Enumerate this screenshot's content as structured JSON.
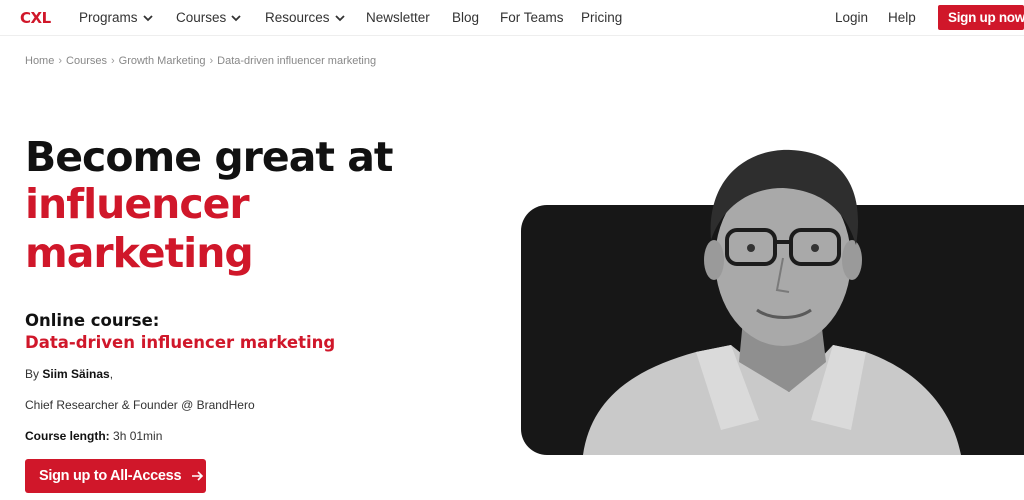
{
  "nav": {
    "logo": "CXL",
    "items": [
      {
        "label": "Programs",
        "dropdown": true
      },
      {
        "label": "Courses",
        "dropdown": true
      },
      {
        "label": "Resources",
        "dropdown": true
      },
      {
        "label": "Newsletter"
      },
      {
        "label": "Blog"
      },
      {
        "label": "For Teams"
      },
      {
        "label": "Pricing"
      }
    ],
    "login": "Login",
    "help": "Help",
    "signup": "Sign up now"
  },
  "breadcrumb": [
    "Home",
    "Courses",
    "Growth Marketing",
    "Data-driven influencer marketing"
  ],
  "hero": {
    "title_line1": "Become great at",
    "title_line2": "influencer",
    "title_line3": "marketing",
    "course_type": "Online course:",
    "course_name": "Data-driven influencer marketing",
    "by_prefix": "By",
    "author": "Siim Säinas",
    "author_suffix": ",",
    "author_role": "Chief Researcher & Founder @ BrandHero",
    "length_label": "Course length:",
    "length_value": "3h 01min",
    "cta": "Sign up to All-Access"
  },
  "colors": {
    "brand_red": "#d0172a",
    "dark": "#171717"
  },
  "icons": {
    "dropdown": "chevron-down-icon",
    "cta_arrow": "arrow-right-icon"
  }
}
